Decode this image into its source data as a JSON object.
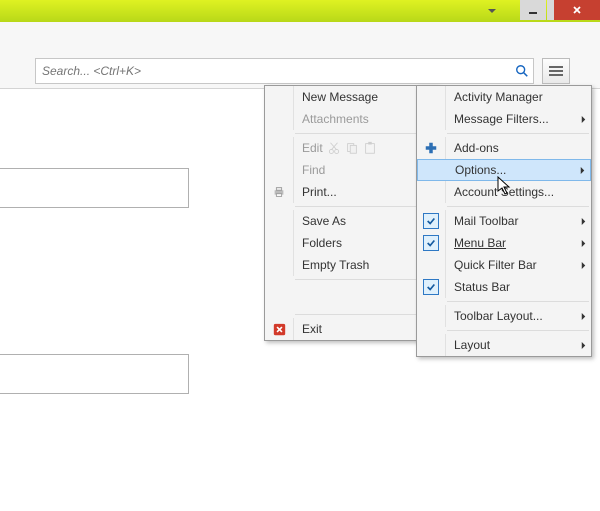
{
  "search": {
    "placeholder": "Search... <Ctrl+K>"
  },
  "menu1": {
    "new_message": "New Message",
    "attachments": "Attachments",
    "edit": "Edit",
    "find": "Find",
    "print": "Print...",
    "save_as": "Save As",
    "folders": "Folders",
    "empty_trash": "Empty Trash",
    "exit": "Exit"
  },
  "menu2": {
    "activity_manager": "Activity Manager",
    "message_filters": "Message Filters...",
    "addons": "Add-ons",
    "options": "Options...",
    "account_settings": "Account Settings...",
    "mail_toolbar": "Mail Toolbar",
    "menu_bar": "Menu Bar",
    "quick_filter_bar": "Quick Filter Bar",
    "status_bar": "Status Bar",
    "toolbar_layout": "Toolbar Layout...",
    "layout": "Layout"
  }
}
